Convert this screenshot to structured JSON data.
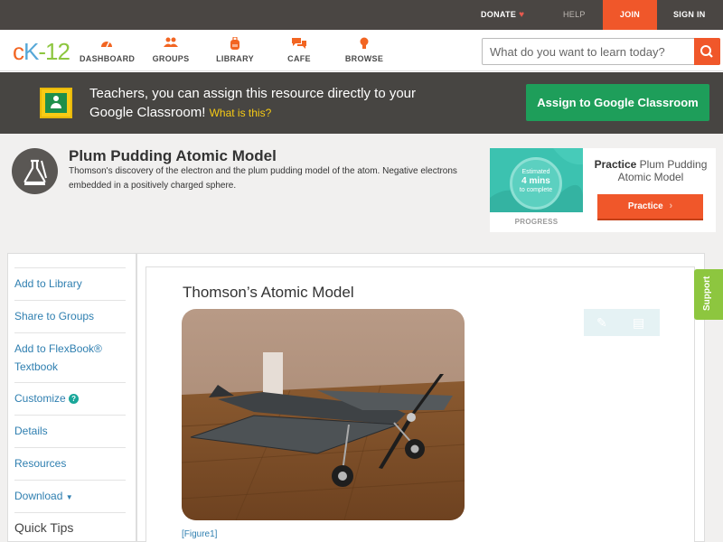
{
  "topbar": {
    "donate": "DONATE",
    "help": "HELP",
    "join": "JOIN",
    "signin": "SIGN IN"
  },
  "nav": {
    "logo": {
      "c": "c",
      "k": "K",
      "dash": "-",
      "n": "12"
    },
    "items": [
      {
        "label": "DASHBOARD",
        "icon": "dashboard-gauge-icon"
      },
      {
        "label": "GROUPS",
        "icon": "groups-people-icon"
      },
      {
        "label": "LIBRARY",
        "icon": "library-backpack-icon"
      },
      {
        "label": "CAFE",
        "icon": "cafe-chat-icon"
      },
      {
        "label": "BROWSE",
        "icon": "browse-bulb-icon"
      }
    ],
    "search_placeholder": "What do you want to learn today?"
  },
  "banner": {
    "text": "Teachers, you can assign this resource directly to your Google Classroom!",
    "what": "What is this?",
    "assign": "Assign to Google Classroom"
  },
  "concept": {
    "title": "Plum Pudding Atomic Model",
    "description": "Thomson's discovery of the electron and the plum pudding model of the atom. Negative electrons embedded in a positively charged sphere."
  },
  "practice": {
    "estimated": "Estimated",
    "mins": "4 mins",
    "to_complete": "to complete",
    "progress": "PROGRESS",
    "title_bold": "Practice",
    "title_rest": "Plum Pudding Atomic Model",
    "button": "Practice"
  },
  "sidebar": {
    "items": [
      "Add to Library",
      "Share to Groups",
      "Add to FlexBook®",
      "Textbook",
      "Customize",
      "Details",
      "Resources",
      "Download"
    ],
    "quick_tips": "Quick Tips"
  },
  "content": {
    "section_title": "Thomson’s Atomic Model",
    "figure_link": "[Figure1]"
  },
  "support": "Support",
  "colors": {
    "accent": "#f0572a",
    "green": "#1e9e5a",
    "link": "#2f7fb0"
  }
}
